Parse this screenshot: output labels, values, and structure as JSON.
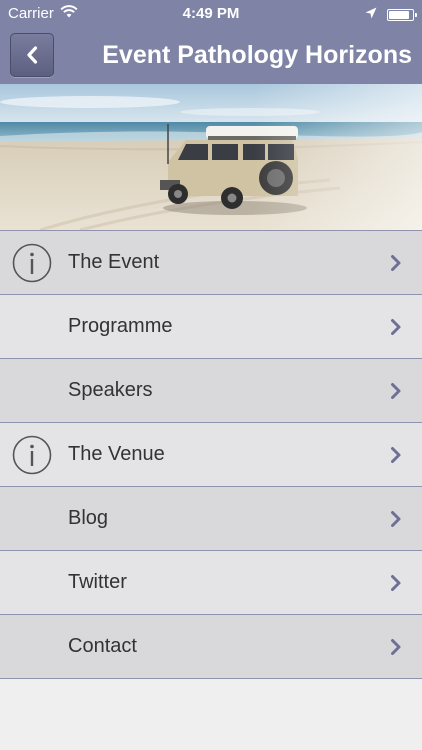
{
  "status_bar": {
    "carrier": "Carrier",
    "time": "4:49 PM",
    "wifi_icon": "wifi-icon",
    "location_icon": "location-arrow-icon",
    "battery_icon": "battery-icon",
    "battery_level": 0.9
  },
  "nav_bar": {
    "back_icon": "chevron-left-icon",
    "title": "Event Pathology Horizons",
    "background_color": "#7f83a6"
  },
  "banner": {
    "image": "beach-4wd-vehicle-photo"
  },
  "menu": {
    "items": [
      {
        "label": "The Event",
        "icon": "info-icon"
      },
      {
        "label": "Programme",
        "icon": ""
      },
      {
        "label": "Speakers",
        "icon": ""
      },
      {
        "label": "The Venue",
        "icon": "info-icon"
      },
      {
        "label": "Blog",
        "icon": ""
      },
      {
        "label": "Twitter",
        "icon": ""
      },
      {
        "label": "Contact",
        "icon": ""
      }
    ],
    "chevron_icon": "chevron-right-icon",
    "chevron_color": "#6d7196"
  }
}
